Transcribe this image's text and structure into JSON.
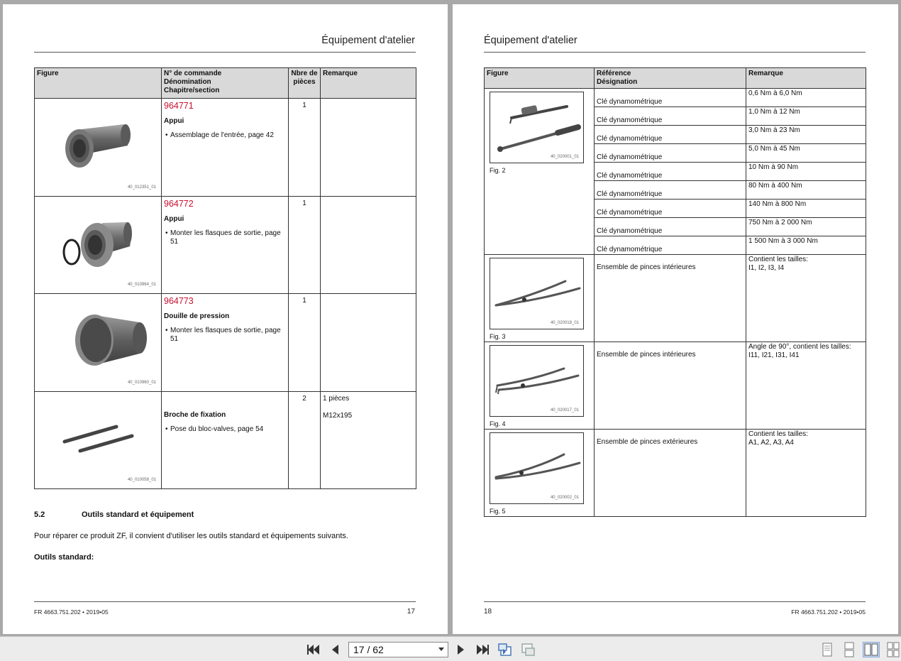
{
  "left_page": {
    "running_title": "Équipement d'atelier",
    "table": {
      "headers": {
        "figure": "Figure",
        "order": "N° de commande",
        "denomination": "Dénomination",
        "chapter": "Chapitre/section",
        "qty_line1": "Nbre de",
        "qty_line2": "pièces",
        "remark": "Remarque"
      },
      "rows": [
        {
          "code": "40_012351_01",
          "order_no": "964771",
          "denomination": "Appui",
          "chapter": "Assemblage de l'entrée, page 42",
          "qty": "1",
          "remark1": "",
          "remark2": ""
        },
        {
          "code": "40_010964_01",
          "order_no": "964772",
          "denomination": "Appui",
          "chapter": "Monter les flasques de sortie, page 51",
          "qty": "1",
          "remark1": "",
          "remark2": ""
        },
        {
          "code": "40_010960_01",
          "order_no": "964773",
          "denomination": "Douille de pression",
          "chapter": "Monter les flasques de sortie, page 51",
          "qty": "1",
          "remark1": "",
          "remark2": ""
        },
        {
          "code": "40_010058_01",
          "order_no": "",
          "denomination": "Broche de fixation",
          "chapter": "Pose du bloc-valves, page 54",
          "qty": "2",
          "remark1": "1 pièces",
          "remark2": "M12x195"
        }
      ]
    },
    "section_number": "5.2",
    "section_title": "Outils standard et équipement",
    "intro": "Pour réparer ce produit ZF, il convient d'utiliser les outils standard et équipements suivants.",
    "std_tools_heading": "Outils standard:",
    "footer_doc": "FR 4663.751.202 • 2019•05",
    "page_number": "17"
  },
  "right_page": {
    "running_title": "Équipement d'atelier",
    "table": {
      "headers": {
        "figure": "Figure",
        "reference": "Référence",
        "designation": "Désignation",
        "remark": "Remarque"
      },
      "torque_fig": {
        "code": "40_020001_01",
        "caption": "Fig. 2"
      },
      "torque_rows": [
        {
          "designation": "Clé dynamométrique",
          "range": "0,6 Nm à 6,0 Nm"
        },
        {
          "designation": "Clé dynamométrique",
          "range": "1,0 Nm à 12 Nm"
        },
        {
          "designation": "Clé dynamométrique",
          "range": "3,0 Nm à 23 Nm"
        },
        {
          "designation": "Clé dynamométrique",
          "range": "5,0 Nm à 45 Nm"
        },
        {
          "designation": "Clé dynamométrique",
          "range": "10 Nm à 90 Nm"
        },
        {
          "designation": "Clé dynamométrique",
          "range": "80 Nm à 400 Nm"
        },
        {
          "designation": "Clé dynamométrique",
          "range": "140 Nm à 800 Nm"
        },
        {
          "designation": "Clé dynamométrique",
          "range": "750 Nm à 2 000 Nm"
        },
        {
          "designation": "Clé dynamométrique",
          "range": "1 500 Nm à 3 000 Nm"
        }
      ],
      "plier_rows": [
        {
          "code": "40_020018_01",
          "caption": "Fig. 3",
          "designation": "Ensemble de pinces intérieures",
          "remark1": "Contient les tailles:",
          "remark2": "I1, I2, I3, I4"
        },
        {
          "code": "40_020017_01",
          "caption": "Fig. 4",
          "designation": "Ensemble de pinces intérieures",
          "remark1": "Angle de 90°, contient les tailles:",
          "remark2": "I11, I21, I31, I41"
        },
        {
          "code": "40_020002_01",
          "caption": "Fig. 5",
          "designation": "Ensemble de pinces extérieures",
          "remark1": "Contient les tailles:",
          "remark2": "A1, A2, A3, A4"
        }
      ]
    },
    "page_number": "18",
    "footer_doc": "FR 4663.751.202 • 2019•05"
  },
  "toolbar": {
    "page_indicator": "17 / 62",
    "icons": [
      "first-page-icon",
      "previous-page-icon",
      "next-page-icon",
      "last-page-icon",
      "go-back-icon",
      "go-forward-icon",
      "single-page-view-icon",
      "continuous-view-icon",
      "two-page-view-icon",
      "two-page-continuous-view-icon"
    ],
    "active_view": "two-page-view-icon"
  }
}
